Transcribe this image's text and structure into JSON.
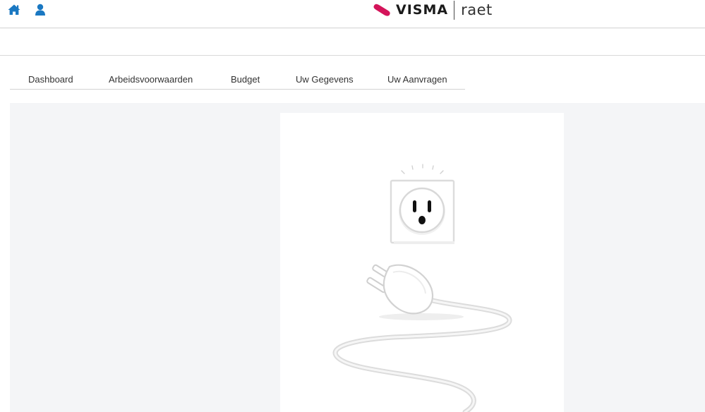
{
  "header": {
    "icons": [
      "home-icon",
      "user-icon"
    ],
    "icon_color": "#1a78c2",
    "logo": {
      "brand": "VISMA",
      "sub": "raet",
      "mark_color": "#d4145a"
    }
  },
  "nav": {
    "tabs": [
      {
        "label": "Dashboard"
      },
      {
        "label": "Arbeidsvoorwaarden"
      },
      {
        "label": "Budget"
      },
      {
        "label": "Uw Gegevens"
      },
      {
        "label": "Uw Aanvragen"
      }
    ]
  },
  "main": {
    "background": "#f4f5f7",
    "illustration": "unplugged-outlet-illustration"
  }
}
